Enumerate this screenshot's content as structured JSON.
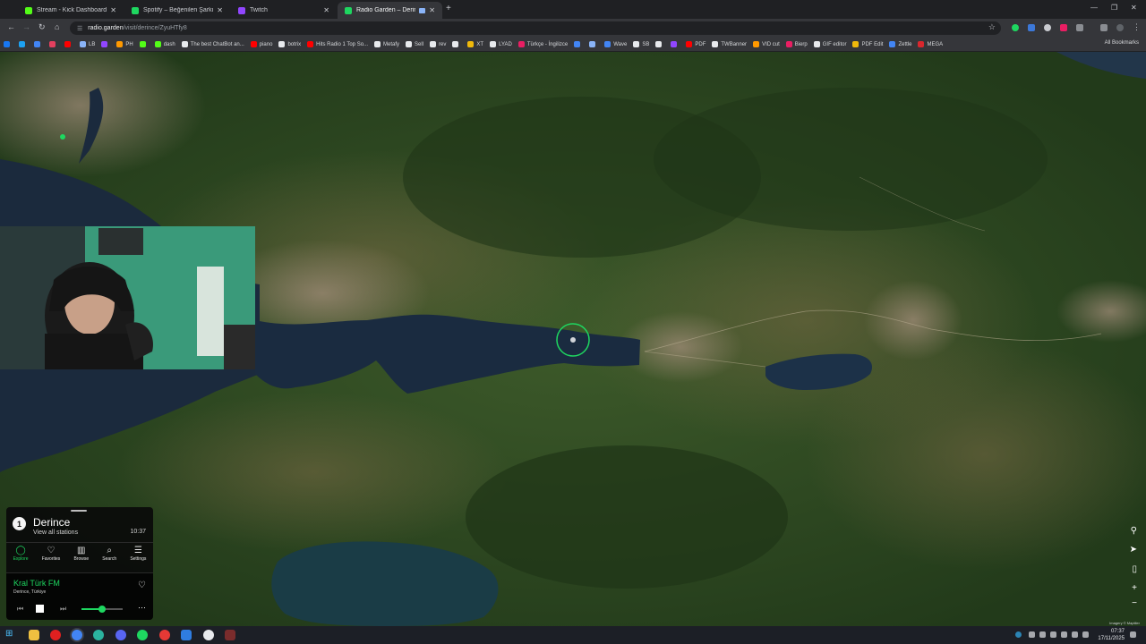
{
  "browser": {
    "tabs": [
      {
        "title": "Stream - Kick Dashboard",
        "color": "#53fc18",
        "active": false
      },
      {
        "title": "Spotify – Beğenilen Şarkılar",
        "color": "#1ed760",
        "active": false
      },
      {
        "title": "Twitch",
        "color": "#9146ff",
        "active": false
      },
      {
        "title": "Radio Garden – Derince",
        "color": "#1ed760",
        "active": true
      }
    ],
    "url_domain": "radio.garden",
    "url_path": "/visit/derince/ZyuHTfy8",
    "bookmarks": [
      {
        "label": "",
        "color": "#1877f2"
      },
      {
        "label": "",
        "color": "#1da1f2"
      },
      {
        "label": "",
        "color": "#4285f4"
      },
      {
        "label": "",
        "color": "#e4405f"
      },
      {
        "label": "",
        "color": "#ff0000"
      },
      {
        "label": "LB",
        "color": "#8ab4f8"
      },
      {
        "label": "",
        "color": "#9146ff"
      },
      {
        "label": "PH",
        "color": "#ff9900"
      },
      {
        "label": "",
        "color": "#53fc18"
      },
      {
        "label": "dash",
        "color": "#53fc18"
      },
      {
        "label": "The best ChatBot an...",
        "color": "#e8eaed"
      },
      {
        "label": "piano",
        "color": "#ff0000"
      },
      {
        "label": "botrix",
        "color": "#e8eaed"
      },
      {
        "label": "Hits Radio 1 Top So...",
        "color": "#ff0000"
      },
      {
        "label": "Metafy",
        "color": "#e8eaed"
      },
      {
        "label": "Sell",
        "color": "#e8eaed"
      },
      {
        "label": "rev",
        "color": "#e8eaed"
      },
      {
        "label": "",
        "color": "#e8eaed"
      },
      {
        "label": "XT",
        "color": "#f0b90b"
      },
      {
        "label": "LYAD",
        "color": "#e8eaed"
      },
      {
        "label": "Türkçe - İngilizce",
        "color": "#e91e63"
      },
      {
        "label": "",
        "color": "#4285f4"
      },
      {
        "label": "",
        "color": "#8ab4f8"
      },
      {
        "label": "Wave",
        "color": "#4285f4"
      },
      {
        "label": "SB",
        "color": "#e8eaed"
      },
      {
        "label": "",
        "color": "#e8eaed"
      },
      {
        "label": "",
        "color": "#9146ff"
      },
      {
        "label": "PDF",
        "color": "#ff0000"
      },
      {
        "label": "TWBanner",
        "color": "#e8eaed"
      },
      {
        "label": "VID cut",
        "color": "#ff9900"
      },
      {
        "label": "Bierp",
        "color": "#e91e63"
      },
      {
        "label": "GIF editor",
        "color": "#e8eaed"
      },
      {
        "label": "PDF Edit",
        "color": "#f0b90b"
      },
      {
        "label": "Zettle",
        "color": "#4285f4"
      },
      {
        "label": "MEGA",
        "color": "#d9272e"
      }
    ],
    "all_bookmarks": "All Bookmarks"
  },
  "map": {
    "attribution": "Imagery © Maptiler"
  },
  "radio_garden": {
    "badge": "1",
    "place": "Derince",
    "view_all": "View all stations",
    "local_time": "10:37",
    "tabs": [
      {
        "label": "Explore",
        "icon": "explore-icon",
        "glyph": "◯",
        "active": true
      },
      {
        "label": "Favorites",
        "icon": "heart-icon",
        "glyph": "♡",
        "active": false
      },
      {
        "label": "Browse",
        "icon": "map-icon",
        "glyph": "▥",
        "active": false
      },
      {
        "label": "Search",
        "icon": "search-icon",
        "glyph": "⌕",
        "active": false
      },
      {
        "label": "Settings",
        "icon": "menu-icon",
        "glyph": "☰",
        "active": false
      }
    ],
    "station": "Kral Türk FM",
    "station_location": "Derince, Türkiye",
    "volume": 0.5
  },
  "taskbar": {
    "time": "07:37",
    "date": "17/11/2025"
  }
}
